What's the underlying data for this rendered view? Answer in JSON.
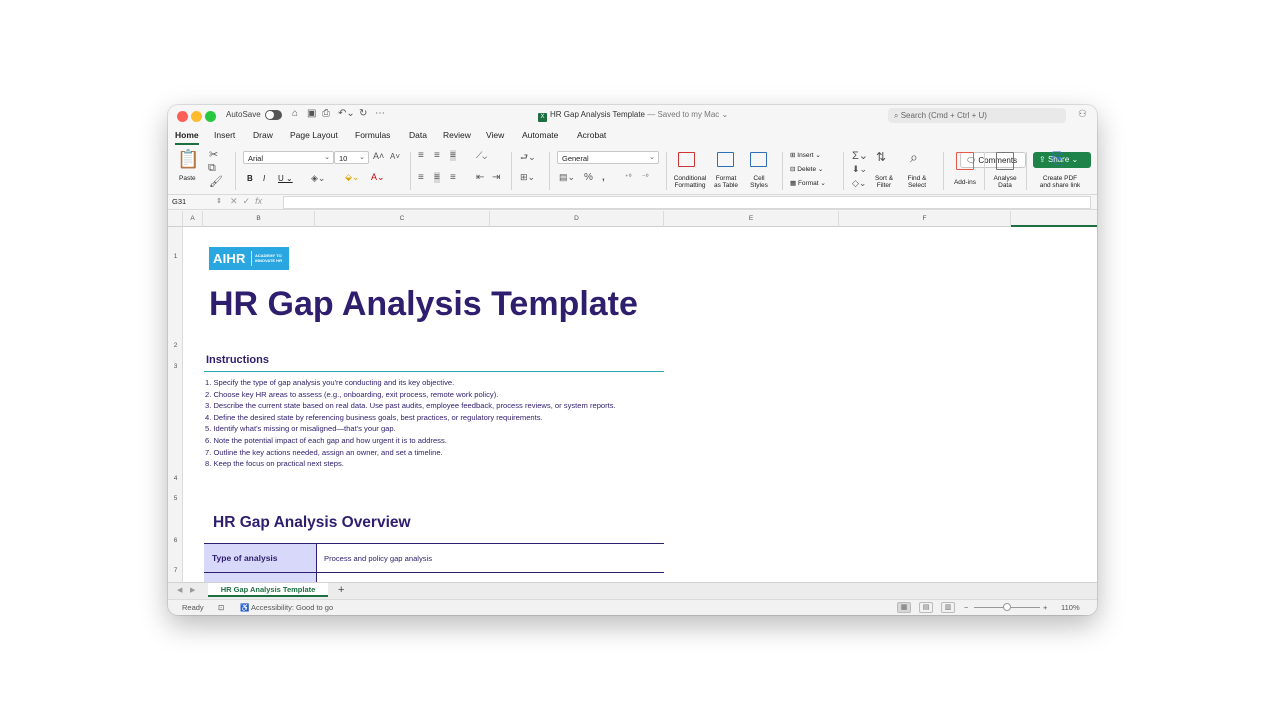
{
  "titlebar": {
    "autosave_label": "AutoSave",
    "doc_title": "HR Gap Analysis Template",
    "saved_status": "— Saved to my Mac ⌄",
    "search_placeholder": "Search (Cmd + Ctrl + U)"
  },
  "tabs": [
    "Home",
    "Insert",
    "Draw",
    "Page Layout",
    "Formulas",
    "Data",
    "Review",
    "View",
    "Automate",
    "Acrobat"
  ],
  "actions": {
    "comments": "Comments",
    "share": "Share"
  },
  "ribbon": {
    "paste": "Paste",
    "font_name": "Arial",
    "font_size": "10",
    "number_format": "General",
    "conditional_formatting": [
      "Conditional",
      "Formatting"
    ],
    "format_as_table": [
      "Format",
      "as Table"
    ],
    "cell_styles": [
      "Cell",
      "Styles"
    ],
    "insert": "Insert",
    "delete": "Delete",
    "format": "Format",
    "sort_filter": [
      "Sort &",
      "Filter"
    ],
    "find_select": [
      "Find &",
      "Select"
    ],
    "add_ins": "Add-ins",
    "analyse_data": [
      "Analyse",
      "Data"
    ],
    "create_pdf": [
      "Create PDF",
      "and share link"
    ]
  },
  "formula_bar": {
    "cell_ref": "G31",
    "fx": "fx",
    "value": ""
  },
  "columns": [
    "A",
    "B",
    "C",
    "D",
    "E",
    "F"
  ],
  "rows": [
    "1",
    "2",
    "3",
    "4",
    "5",
    "6",
    "7"
  ],
  "sheet": {
    "logo_text": "AIHR",
    "logo_tagline": "ACADEMY TO INNOVATE HR",
    "title": "HR Gap Analysis Template",
    "instructions_heading": "Instructions",
    "instructions": [
      "1. Specify the type of gap analysis you're conducting and its key objective.",
      "2. Choose key HR areas to assess (e.g., onboarding, exit process, remote work policy).",
      "3. Describe the current state based on real data. Use past audits, employee feedback, process reviews, or system reports.",
      "4. Define the desired state by referencing business goals, best practices, or regulatory requirements.",
      "5. Identify what's missing or misaligned—that's your gap.",
      "6. Note the potential impact of each gap and how urgent it is to address.",
      "7. Outline the key actions needed, assign an owner, and set a timeline.",
      "8. Keep the focus on practical next steps."
    ],
    "overview_heading": "HR Gap Analysis Overview",
    "overview_rows": [
      {
        "label": "Type of analysis",
        "value": "Process and policy gap analysis"
      }
    ]
  },
  "sheet_tabs": {
    "active": "HR Gap Analysis Template",
    "add": "+"
  },
  "status": {
    "ready": "Ready",
    "accessibility": "Accessibility: Good to go",
    "zoom": "110%"
  },
  "colors": {
    "brand_green": "#1d6f42",
    "title_navy": "#2f1e6e",
    "logo_blue": "#2aa7e0",
    "label_bg": "#d8d8fa"
  }
}
